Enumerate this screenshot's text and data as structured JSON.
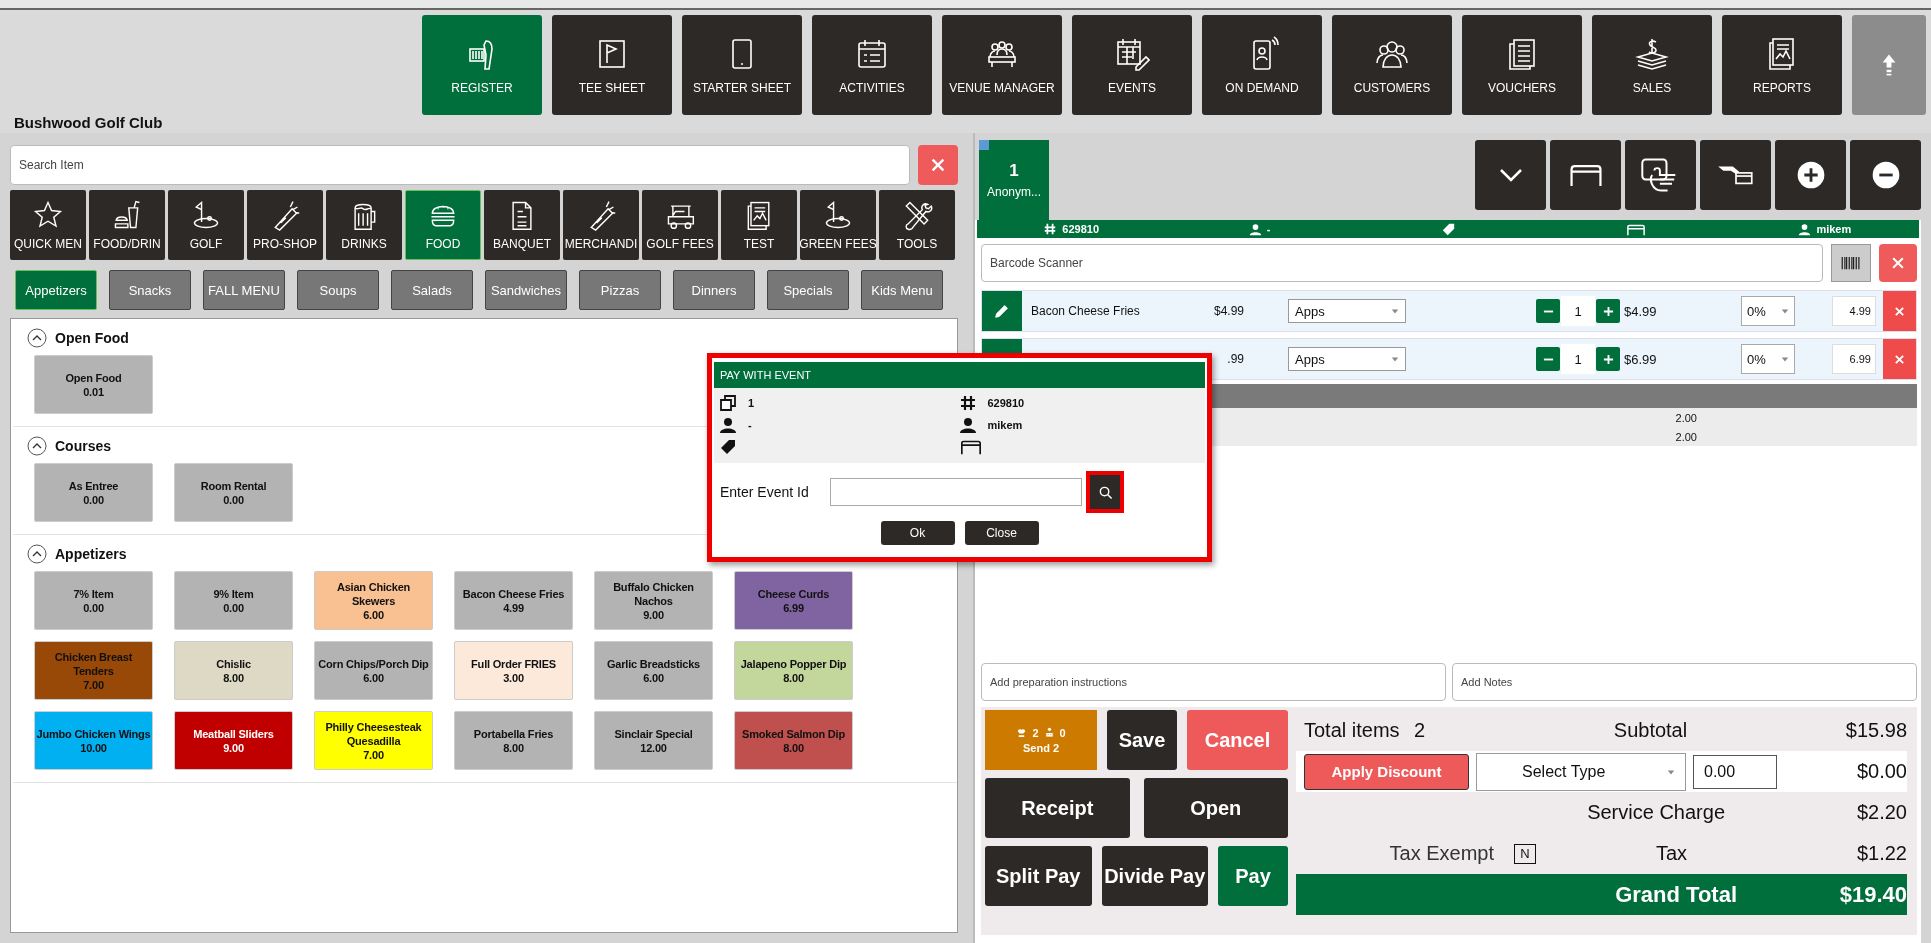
{
  "header": {
    "venue": "Bushwood Golf Club"
  },
  "nav": [
    {
      "label": "REGISTER",
      "selected": true
    },
    {
      "label": "TEE SHEET",
      "selected": false
    },
    {
      "label": "STARTER SHEET",
      "selected": false
    },
    {
      "label": "ACTIVITIES",
      "selected": false
    },
    {
      "label": "VENUE MANAGER",
      "selected": false
    },
    {
      "label": "EVENTS",
      "selected": false
    },
    {
      "label": "ON DEMAND",
      "selected": false
    },
    {
      "label": "CUSTOMERS",
      "selected": false
    },
    {
      "label": "VOUCHERS",
      "selected": false
    },
    {
      "label": "SALES",
      "selected": false
    },
    {
      "label": "REPORTS",
      "selected": false
    }
  ],
  "search": {
    "placeholder": "Search Item"
  },
  "categories": [
    {
      "label": "QUICK MEN",
      "selected": false
    },
    {
      "label": "FOOD/DRIN",
      "selected": false
    },
    {
      "label": "GOLF",
      "selected": false
    },
    {
      "label": "PRO-SHOP",
      "selected": false
    },
    {
      "label": "DRINKS",
      "selected": false
    },
    {
      "label": "FOOD",
      "selected": true
    },
    {
      "label": "BANQUET",
      "selected": false
    },
    {
      "label": "MERCHANDI",
      "selected": false
    },
    {
      "label": "GOLF FEES",
      "selected": false
    },
    {
      "label": "TEST",
      "selected": false
    },
    {
      "label": "GREEN FEES",
      "selected": false
    },
    {
      "label": "TOOLS",
      "selected": false
    }
  ],
  "subcategories": [
    {
      "label": "Appetizers",
      "selected": true
    },
    {
      "label": "Snacks",
      "selected": false
    },
    {
      "label": "FALL MENU",
      "selected": false
    },
    {
      "label": "Soups",
      "selected": false
    },
    {
      "label": "Salads",
      "selected": false
    },
    {
      "label": "Sandwiches",
      "selected": false
    },
    {
      "label": "Pizzas",
      "selected": false
    },
    {
      "label": "Dinners",
      "selected": false
    },
    {
      "label": "Specials",
      "selected": false
    },
    {
      "label": "Kids Menu",
      "selected": false
    }
  ],
  "sections": [
    {
      "title": "Open Food",
      "expanded": true,
      "items": [
        {
          "name": "Open Food",
          "price": "0.01",
          "color": "#b3b3b3"
        }
      ]
    },
    {
      "title": "Courses",
      "expanded": true,
      "items": [
        {
          "name": "As Entree",
          "price": "0.00",
          "color": "#b3b3b3"
        },
        {
          "name": "Room Rental",
          "price": "0.00",
          "color": "#b3b3b3"
        }
      ]
    },
    {
      "title": "Appetizers",
      "expanded": true,
      "items": [
        {
          "name": "7% Item",
          "price": "0.00",
          "color": "#b3b3b3"
        },
        {
          "name": "9% Item",
          "price": "0.00",
          "color": "#b3b3b3"
        },
        {
          "name": "Asian Chicken Skewers",
          "price": "6.00",
          "color": "#f9c091"
        },
        {
          "name": "Bacon Cheese Fries",
          "price": "4.99",
          "color": "#b3b3b3"
        },
        {
          "name": "Buffalo Chicken Nachos",
          "price": "9.00",
          "color": "#b3b3b3"
        },
        {
          "name": "Cheese Curds",
          "price": "6.99",
          "color": "#8064a2"
        },
        {
          "name": "Chicken Breast Tenders",
          "price": "7.00",
          "color": "#984807"
        },
        {
          "name": "Chislic",
          "price": "8.00",
          "color": "#ddd9c4"
        },
        {
          "name": "Corn Chips/Porch Dip",
          "price": "6.00",
          "color": "#b3b3b3"
        },
        {
          "name": "Full Order FRIES",
          "price": "3.00",
          "color": "#fde9da"
        },
        {
          "name": "Garlic Breadsticks",
          "price": "6.00",
          "color": "#b3b3b3"
        },
        {
          "name": "Jalapeno Popper Dip",
          "price": "8.00",
          "color": "#c3d69b"
        },
        {
          "name": "Jumbo Chicken Wings",
          "price": "10.00",
          "color": "#00b0f0"
        },
        {
          "name": "Meatball Sliders",
          "price": "9.00",
          "color": "#c00000"
        },
        {
          "name": "Philly Cheesesteak Quesadilla",
          "price": "7.00",
          "color": "#ffff00"
        },
        {
          "name": "Portabella Fries",
          "price": "8.00",
          "color": "#b3b3b3"
        },
        {
          "name": "Sinclair Special",
          "price": "12.00",
          "color": "#b3b3b3"
        },
        {
          "name": "Smoked Salmon Dip",
          "price": "8.00",
          "color": "#c0504d"
        }
      ]
    }
  ],
  "order_tab": {
    "number": "1",
    "name": "Anonym...",
    "selected": true
  },
  "order_info": {
    "check": "629810",
    "customer": "-",
    "server": "mikem"
  },
  "barcode": {
    "placeholder": "Barcode Scanner"
  },
  "cart": [
    {
      "name": "Bacon Cheese Fries",
      "price": "$4.99",
      "category": "Apps",
      "qty": "1",
      "total": "$4.99",
      "discount": "0%",
      "amount": "4.99"
    },
    {
      "price": ".99",
      "category": "Apps",
      "qty": "1",
      "total": "$6.99",
      "discount": "0%",
      "amount": "6.99"
    }
  ],
  "summary_rows": [
    "2.00",
    "2.00"
  ],
  "prep": {
    "placeholder": "Add preparation instructions"
  },
  "notes": {
    "placeholder": "Add Notes"
  },
  "send": {
    "food_count": "2",
    "drink_count": "0",
    "label": "Send 2"
  },
  "action_rows": [
    [
      {
        "label": "Save",
        "kind": "dark"
      },
      {
        "label": "Cancel",
        "kind": "danger"
      }
    ],
    [
      {
        "label": "Receipt",
        "kind": "dark"
      },
      {
        "label": "Open",
        "kind": "dark"
      }
    ],
    [
      {
        "label": "Split Pay",
        "kind": "dark"
      },
      {
        "label": "Divide Pay",
        "kind": "dark"
      },
      {
        "label": "Pay",
        "kind": "primary"
      }
    ]
  ],
  "totals": {
    "items_label": "Total items",
    "items_count": "2",
    "subtotal_label": "Subtotal",
    "subtotal": "$15.98",
    "discount_button": "Apply Discount",
    "discount_type": "Select Type",
    "discount_value": "0.00",
    "discount": "$0.00",
    "service_label": "Service Charge",
    "service": "$2.20",
    "tax_exempt_label": "Tax Exempt",
    "tax_exempt_value": "N",
    "tax_label": "Tax",
    "tax": "$1.22",
    "grand_label": "Grand Total",
    "grand": "$19.40"
  },
  "modal": {
    "title": "PAY WITH EVENT",
    "order": "1",
    "customer": "-",
    "check": "629810",
    "server": "mikem",
    "field_label": "Enter Event Id",
    "buttons": [
      "Ok",
      "Close"
    ]
  }
}
